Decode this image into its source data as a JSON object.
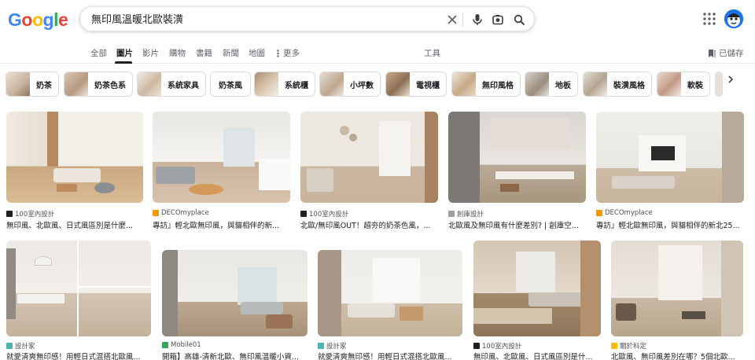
{
  "colors": {
    "google_blue": "#4285F4",
    "google_red": "#EA4335",
    "google_yellow": "#FBBC05",
    "google_green": "#34A853",
    "accent_blue": "#1a73e8"
  },
  "logo": {
    "letters": [
      "G",
      "o",
      "o",
      "g",
      "l",
      "e"
    ]
  },
  "search": {
    "query": "無印風溫暖北歐裝潢",
    "icons": [
      "close-icon",
      "mic-icon",
      "lens-icon",
      "search-icon"
    ]
  },
  "header": {
    "apps_icon": "apps-grid-icon",
    "avatar_icon": "avatar-icon"
  },
  "tabs": {
    "items": [
      "全部",
      "圖片",
      "影片",
      "購物",
      "書籍",
      "新聞",
      "地圖",
      "更多"
    ],
    "active": "圖片",
    "tools": "工具",
    "saved": "已儲存"
  },
  "chips": [
    "奶茶",
    "奶茶色系",
    "系統家具",
    "奶茶風",
    "系統櫃",
    "小坪數",
    "電視櫃",
    "無印風格",
    "地板",
    "裝潢風格",
    "軟裝"
  ],
  "results": [
    {
      "source": "100室內設計",
      "title": "無印風、北歐風、日式風區別是什麼..."
    },
    {
      "source": "DECOmyplace",
      "title": "專訪』輕北歐無印風，與貓相伴的新..."
    },
    {
      "source": "100室內設計",
      "title": "北歐/無印風OUT！超夯的奶茶色風，..."
    },
    {
      "source": "創庫設計",
      "title": "北歐風及無印風有什麼差別? | 創庫空..."
    },
    {
      "source": "DECOmyplace",
      "title": "專訪』輕北歐無印風，與貓相伴的新北25..."
    },
    {
      "source": "設計家",
      "title": "就愛清爽無印感！用輕日式混搭北歐風..."
    },
    {
      "source": "Mobile01",
      "title": "開箱】高雄-清新北歐、無印風溫暖小資..."
    },
    {
      "source": "設計家",
      "title": "就愛清爽無印感！用輕日式混搭北歐風..."
    },
    {
      "source": "100室內設計",
      "title": "無印風、北歐風、日式風區別是什..."
    },
    {
      "source": "關於科定",
      "title": "北歐風、無印風差別在哪？5個北歐..."
    }
  ]
}
